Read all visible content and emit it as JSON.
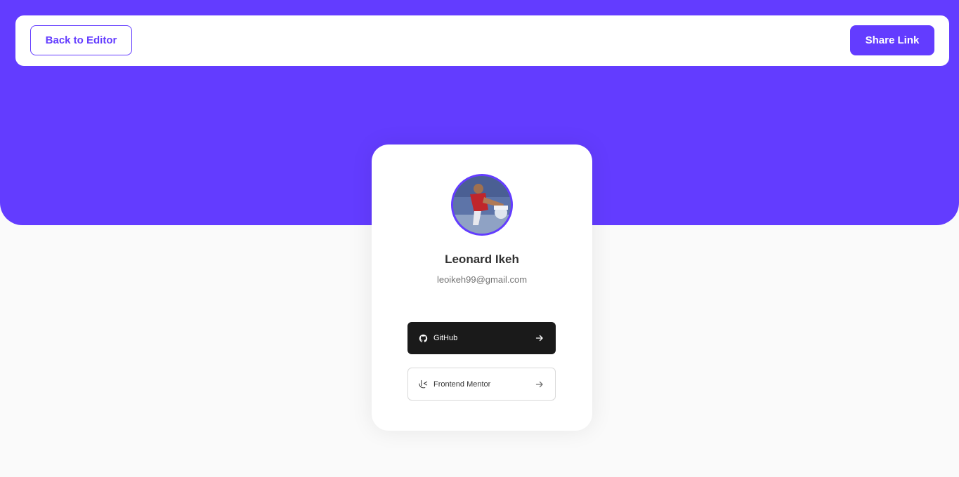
{
  "topbar": {
    "back_label": "Back to Editor",
    "share_label": "Share Link"
  },
  "profile": {
    "name": "Leonard Ikeh",
    "email": "leoikeh99@gmail.com",
    "avatar_icon": "profile-photo"
  },
  "links": [
    {
      "platform": "GitHub",
      "icon": "github-icon",
      "arrow": "arrow-right-icon",
      "bg": "#1A1A1A",
      "fg": "#FFFFFF"
    },
    {
      "platform": "Frontend Mentor",
      "icon": "frontend-mentor-icon",
      "arrow": "arrow-right-icon",
      "bg": "#FFFFFF",
      "fg": "#333333"
    }
  ],
  "colors": {
    "accent": "#633CFF",
    "background": "#FAFAFA",
    "card": "#FFFFFF"
  }
}
